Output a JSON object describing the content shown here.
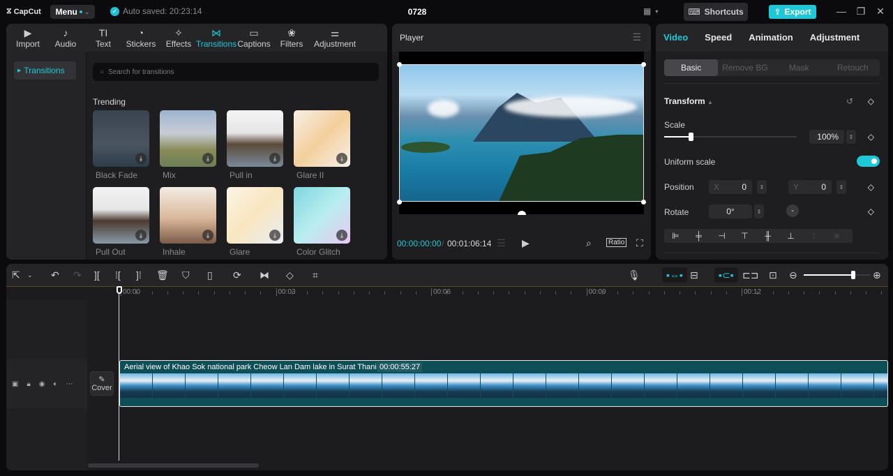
{
  "app": {
    "logo": "CapCut",
    "menu_label": "Menu",
    "autosave": "Auto saved: 20:23:14",
    "project_title": "0728",
    "shortcuts_label": "Shortcuts",
    "export_label": "Export"
  },
  "media": {
    "tools": [
      {
        "label": "Import",
        "icon": "import-icon",
        "glyph": "▶"
      },
      {
        "label": "Audio",
        "icon": "audio-icon",
        "glyph": "♪"
      },
      {
        "label": "Text",
        "icon": "text-icon",
        "glyph": "TI"
      },
      {
        "label": "Stickers",
        "icon": "stickers-icon",
        "glyph": "◔"
      },
      {
        "label": "Effects",
        "icon": "effects-icon",
        "glyph": "✧"
      },
      {
        "label": "Transitions",
        "icon": "transitions-icon",
        "glyph": "⋈"
      },
      {
        "label": "Captions",
        "icon": "captions-icon",
        "glyph": "▭"
      },
      {
        "label": "Filters",
        "icon": "filters-icon",
        "glyph": "❀"
      },
      {
        "label": "Adjustment",
        "icon": "adjustment-icon",
        "glyph": "⚌"
      }
    ],
    "active_tool": "Transitions",
    "category": "Transitions",
    "search_placeholder": "Search for transitions",
    "section_title": "Trending",
    "items": [
      {
        "label": "Black Fade"
      },
      {
        "label": "Mix"
      },
      {
        "label": "Pull in"
      },
      {
        "label": "Glare II"
      },
      {
        "label": "Pull Out"
      },
      {
        "label": "Inhale"
      },
      {
        "label": "Glare"
      },
      {
        "label": "Color Glitch"
      }
    ]
  },
  "player": {
    "title": "Player",
    "current_time": "00:00:00:00",
    "total_time": "00:01:06:14",
    "ratio_label": "Ratio"
  },
  "properties": {
    "tabs": [
      "Video",
      "Speed",
      "Animation",
      "Adjustment"
    ],
    "active_tab": "Video",
    "subtabs": [
      "Basic",
      "Remove BG",
      "Mask",
      "Retouch"
    ],
    "active_subtab": "Basic",
    "section": "Transform",
    "scale_label": "Scale",
    "scale_value": "100%",
    "scale_fraction": 0.2,
    "uniform_scale_label": "Uniform scale",
    "uniform_scale_on": true,
    "position_label": "Position",
    "position_x_axis": "X",
    "position_x": "0",
    "position_y_axis": "Y",
    "position_y": "0",
    "rotate_label": "Rotate",
    "rotate_value": "0°"
  },
  "timeline": {
    "ruler": [
      "00:00",
      "00:03",
      "00:06",
      "00:09",
      "00:12"
    ],
    "cover_label": "Cover",
    "clip_title": "Aerial view of Khao Sok national park Cheow Lan Dam lake in Surat Thani",
    "clip_duration": "00:00:55:27",
    "zoom_fraction": 0.75
  },
  "colors": {
    "accent": "#1ec8d6",
    "clip": "#0e4e56"
  }
}
